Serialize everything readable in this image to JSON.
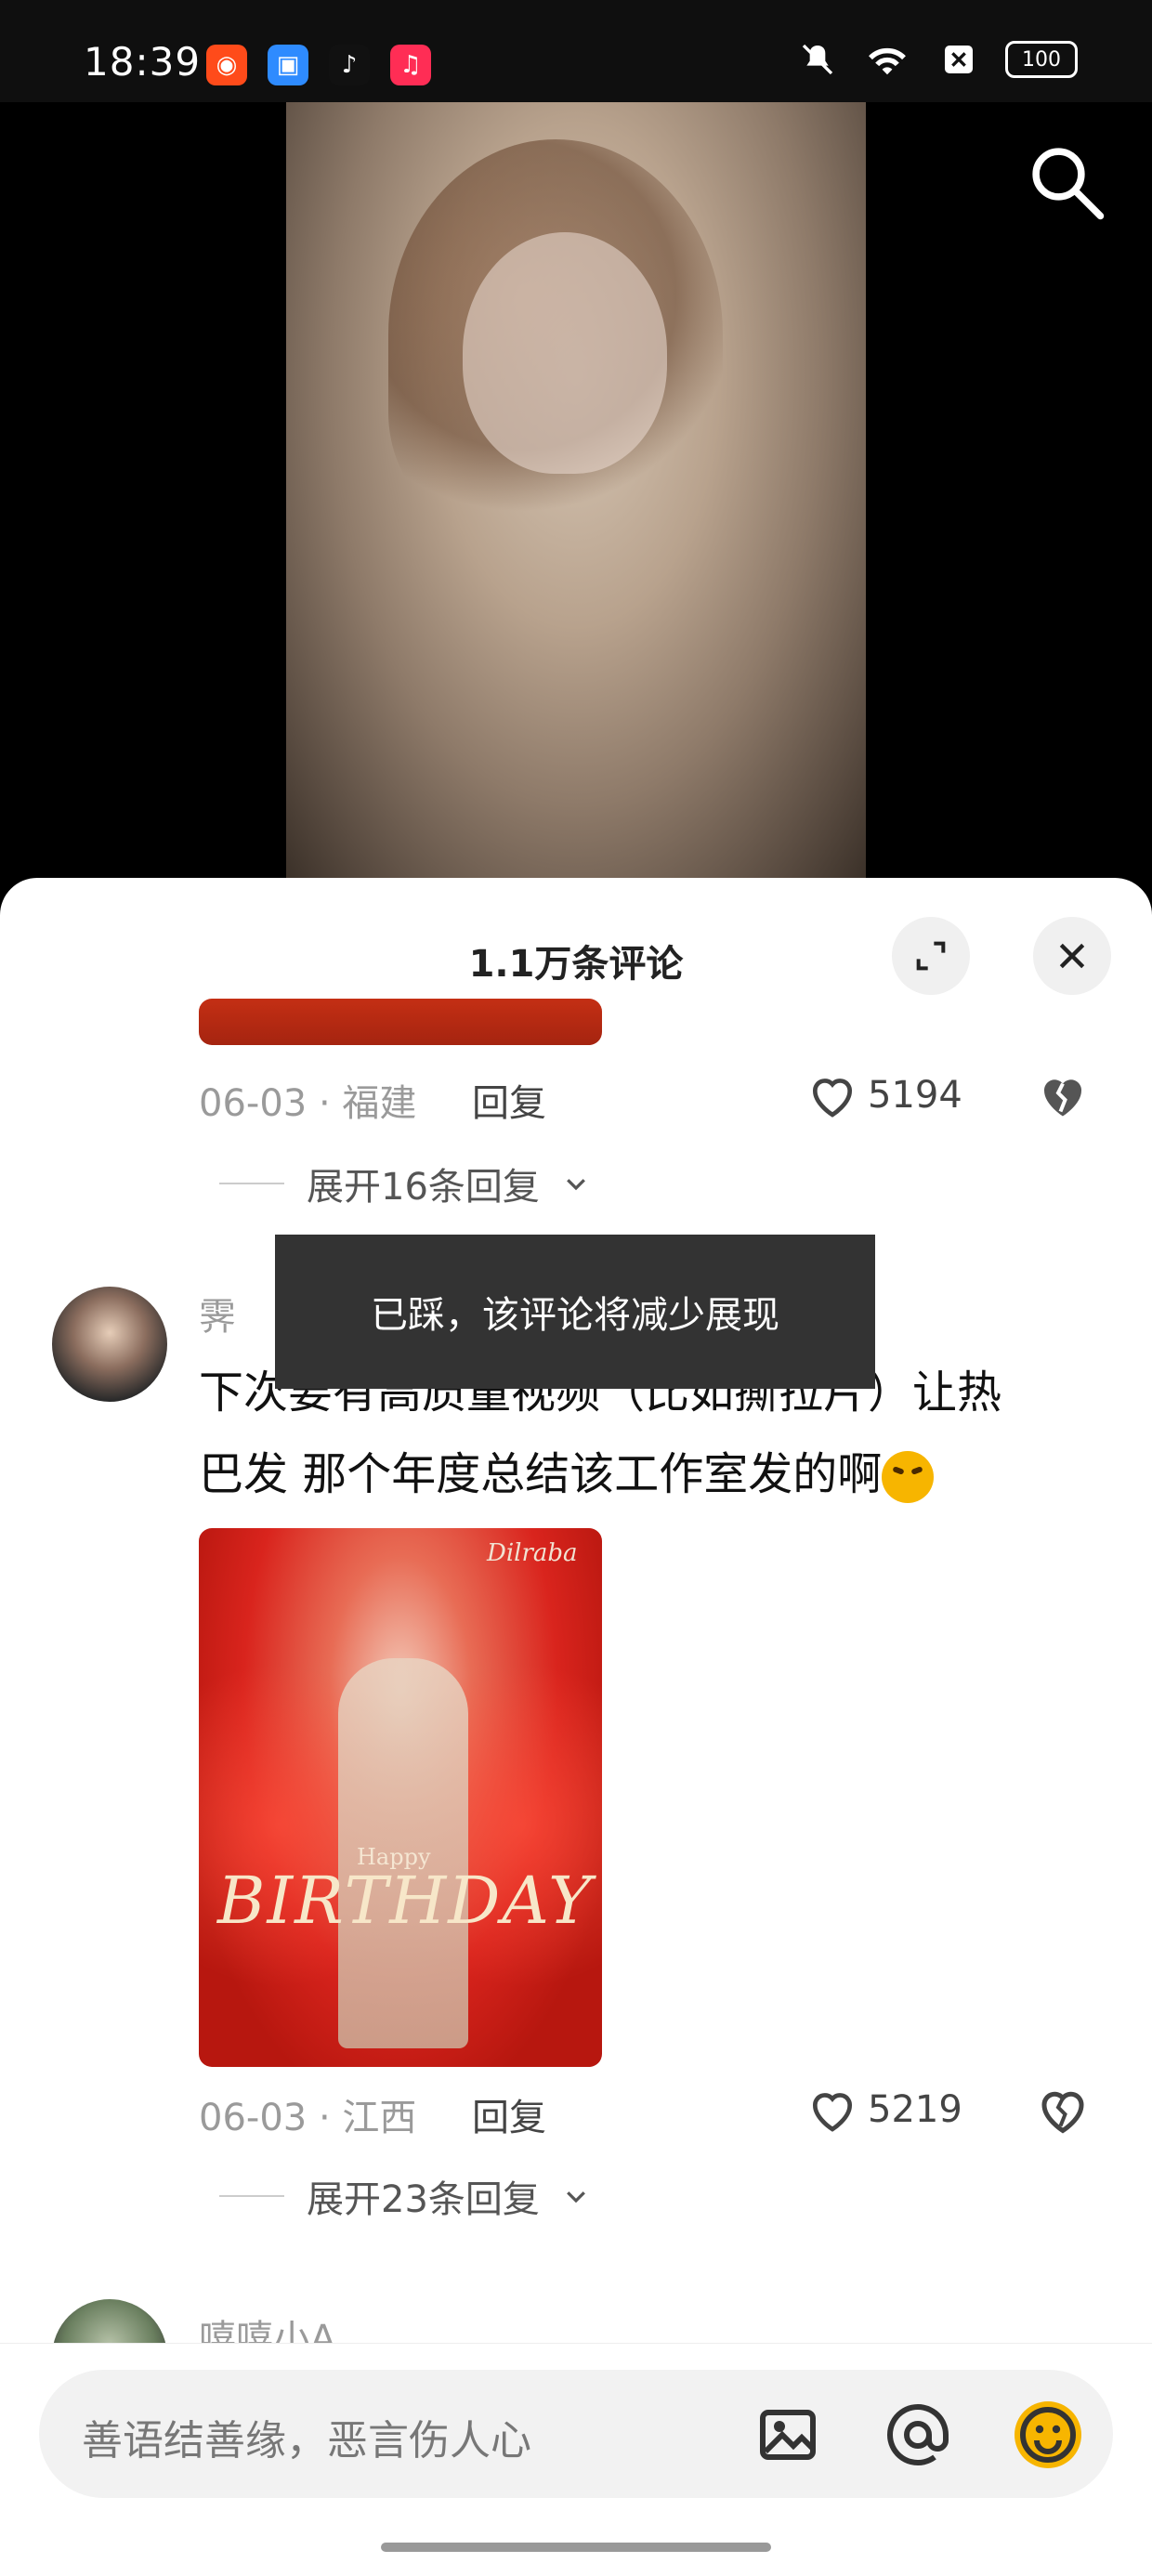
{
  "status_bar": {
    "time": "18:39",
    "apps": [
      {
        "icon": "kuaishou-icon",
        "color": "#ff4b1a",
        "label": ""
      },
      {
        "icon": "blue-app-icon",
        "color": "#2e8bff",
        "label": ""
      },
      {
        "icon": "tiktok-icon",
        "color": "#111111",
        "label": ""
      },
      {
        "icon": "music-icon",
        "color": "#ff2d55",
        "label": ""
      }
    ],
    "battery": "100"
  },
  "video": {
    "search_icon": "search-icon"
  },
  "comments": {
    "title": "1.1万条评论",
    "items": [
      {
        "date_location": "06-03 · 福建",
        "reply_label": "回复",
        "likes": "5194",
        "expand_label": "展开16条回复"
      },
      {
        "username": "霁",
        "text_line1": "下次要有高质量视频（比如撕拉片）让热",
        "text_line2": "巴发 那个年度总结该工作室发的啊",
        "poster_top_mark": "Dilraba",
        "poster_happy": "Happy",
        "poster_birthday": "BIRTHDAY",
        "date_location": "06-03 · 江西",
        "reply_label": "回复",
        "likes": "5219",
        "expand_label": "展开23条回复"
      },
      {
        "username": "嘻嘻小A"
      }
    ],
    "toast": "已踩，该评论将减少展现"
  },
  "input": {
    "placeholder": "善语结善缘，恶言伤人心"
  }
}
